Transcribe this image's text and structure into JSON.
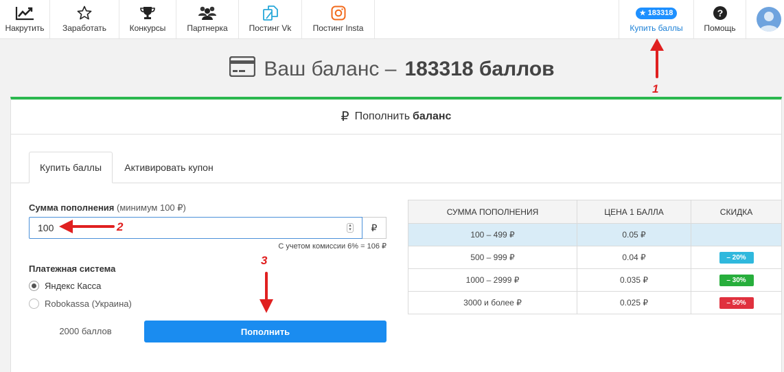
{
  "nav": {
    "items": [
      {
        "label": "Накрутить",
        "icon": "trending-up-icon"
      },
      {
        "label": "Заработать",
        "icon": "star-icon"
      },
      {
        "label": "Конкурсы",
        "icon": "trophy-icon"
      },
      {
        "label": "Партнерка",
        "icon": "users-icon"
      },
      {
        "label": "Постинг Vk",
        "icon": "copy-icon"
      },
      {
        "label": "Постинг Insta",
        "icon": "instagram-icon"
      }
    ],
    "balance_badge": "183318",
    "buy_label": "Купить баллы",
    "help_label": "Помощь"
  },
  "heading": {
    "prefix": "Ваш баланс –",
    "value": "183318 баллов"
  },
  "card": {
    "title_prefix": "Пополнить",
    "title_bold": "баланс",
    "title_icon": "ruble-icon"
  },
  "tabs": [
    "Купить баллы",
    "Активировать купон"
  ],
  "form": {
    "sum_label": "Сумма пополнения",
    "sum_hint": "(минимум 100 ₽)",
    "sum_value": "100",
    "currency": "₽",
    "commission": "С учетом комиссии 6% = 106 ₽",
    "payment_label": "Платежная система",
    "payment_options": [
      {
        "label": "Яндекс Касса",
        "selected": true
      },
      {
        "label": "Robokassa (Украина)",
        "selected": false
      }
    ],
    "points": "2000 баллов",
    "submit": "Пополнить"
  },
  "price_table": {
    "headers": [
      "СУММА ПОПОЛНЕНИЯ",
      "ЦЕНА 1 БАЛЛА",
      "СКИДКА"
    ],
    "rows": [
      {
        "range": "100 – 499 ₽",
        "price": "0.05 ₽",
        "discount": "",
        "discount_color": ""
      },
      {
        "range": "500 – 999 ₽",
        "price": "0.04 ₽",
        "discount": "– 20%",
        "discount_color": "#2fb8dd"
      },
      {
        "range": "1000 – 2999 ₽",
        "price": "0.035 ₽",
        "discount": "– 30%",
        "discount_color": "#27ae3c"
      },
      {
        "range": "3000 и более ₽",
        "price": "0.025 ₽",
        "discount": "– 50%",
        "discount_color": "#e0313e"
      }
    ]
  },
  "annotations": [
    "1",
    "2",
    "3"
  ],
  "colors": {
    "accent": "#1a8cf0",
    "success_bar": "#2bb84f",
    "annotation": "#e02020"
  }
}
